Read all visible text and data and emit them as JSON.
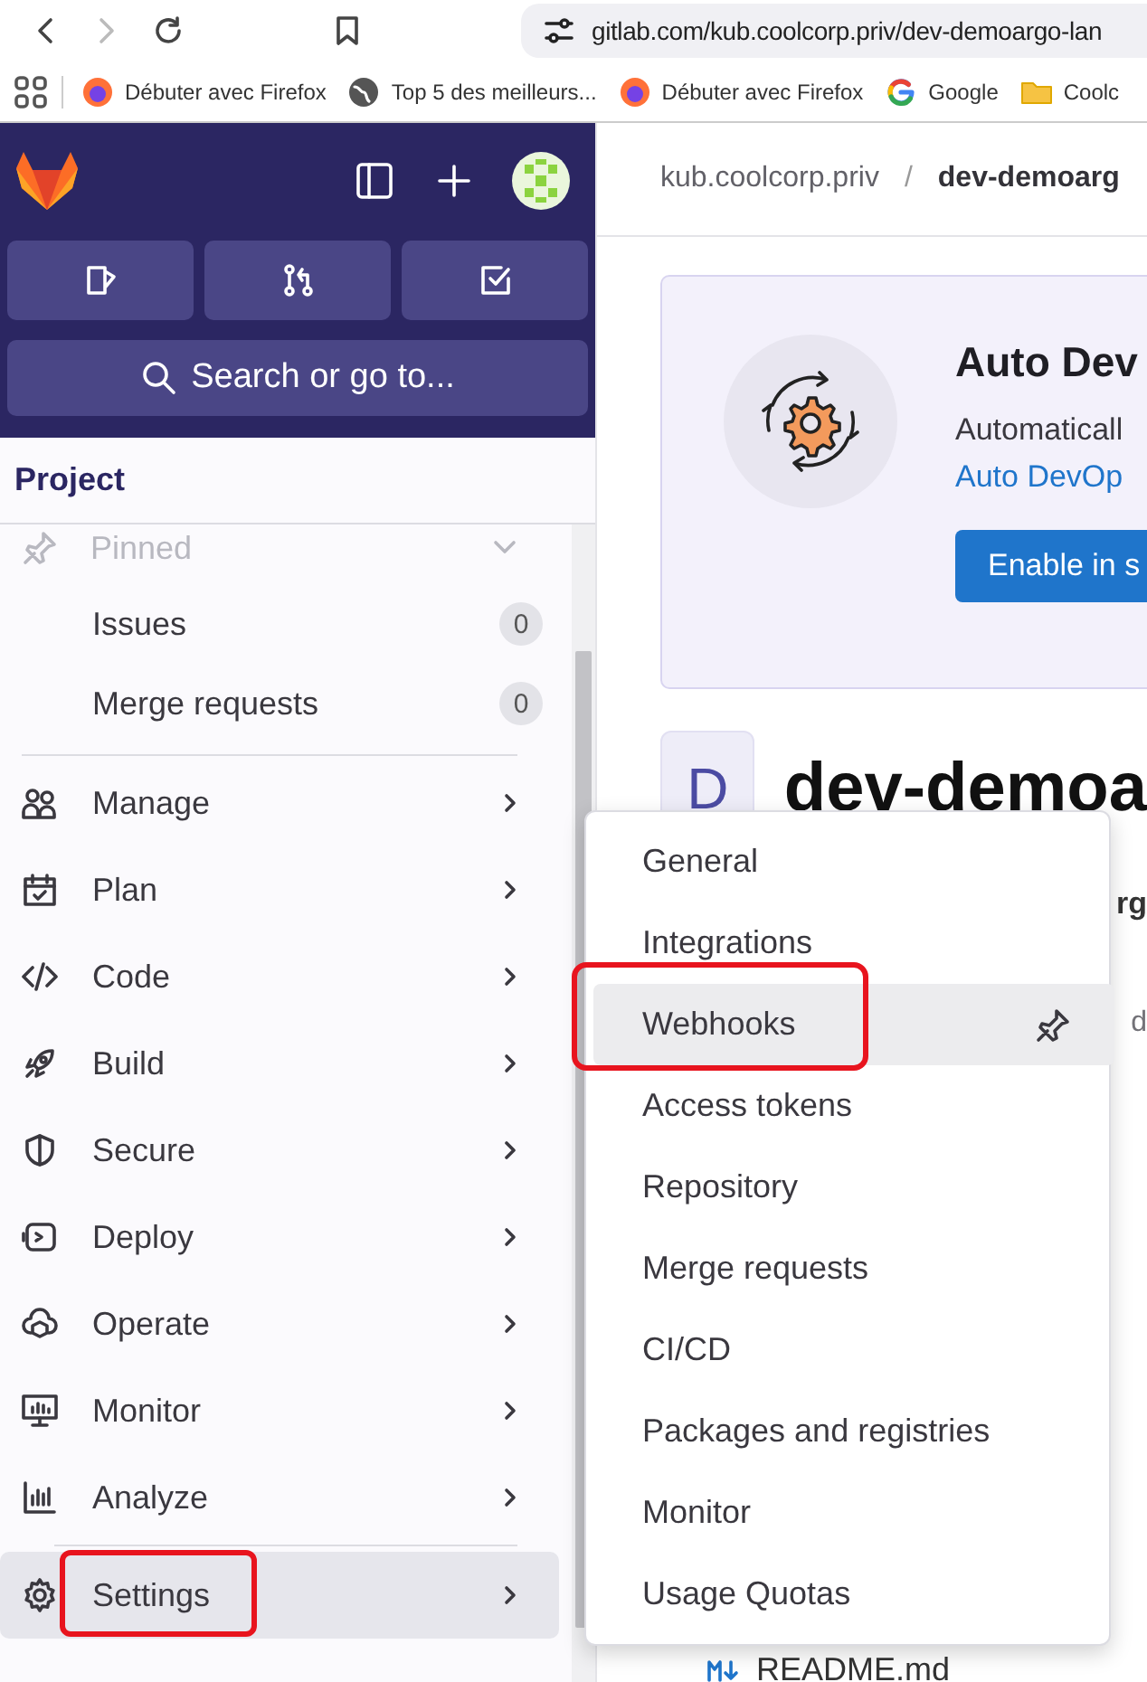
{
  "browser": {
    "back_disabled": false,
    "forward_disabled": true,
    "url": "gitlab.com/kub.coolcorp.priv/dev-demoargo-lan",
    "bookmarks": [
      {
        "label": "Débuter avec Firefox",
        "kind": "firefox"
      },
      {
        "label": "Top 5 des meilleurs...",
        "kind": "globe"
      },
      {
        "label": "Débuter avec Firefox",
        "kind": "firefox"
      },
      {
        "label": "Google",
        "kind": "google"
      },
      {
        "label": "Coolc",
        "kind": "folder"
      }
    ]
  },
  "sidebar": {
    "search": {
      "placeholder": "Search or go to..."
    },
    "context": "Project",
    "pinned": {
      "label": "Pinned",
      "expanded": true,
      "items": [
        {
          "label": "Issues",
          "count": "0"
        },
        {
          "label": "Merge requests",
          "count": "0"
        }
      ]
    },
    "nav": [
      {
        "label": "Manage",
        "selected": false,
        "highlighted": false
      },
      {
        "label": "Plan",
        "selected": false,
        "highlighted": false
      },
      {
        "label": "Code",
        "selected": false,
        "highlighted": false
      },
      {
        "label": "Build",
        "selected": false,
        "highlighted": false
      },
      {
        "label": "Secure",
        "selected": false,
        "highlighted": false
      },
      {
        "label": "Deploy",
        "selected": false,
        "highlighted": false
      },
      {
        "label": "Operate",
        "selected": false,
        "highlighted": false
      },
      {
        "label": "Monitor",
        "selected": false,
        "highlighted": false
      },
      {
        "label": "Analyze",
        "selected": false,
        "highlighted": false
      },
      {
        "label": "Settings",
        "selected": true,
        "highlighted": true
      }
    ]
  },
  "breadcrumb": {
    "items": [
      "kub.coolcorp.priv",
      "dev-demoarg"
    ],
    "separator": "/"
  },
  "banner": {
    "title": "Auto Dev",
    "text": "Automaticall",
    "link": "Auto DevOp",
    "button": "Enable in s"
  },
  "project": {
    "avatar": "D",
    "title": "dev-demoa",
    "fragments": [
      "rg",
      "d"
    ],
    "file": "README.md"
  },
  "flyout": {
    "items": [
      {
        "label": "General",
        "selected": false,
        "highlighted": false
      },
      {
        "label": "Integrations",
        "selected": false,
        "highlighted": false
      },
      {
        "label": "Webhooks",
        "selected": true,
        "highlighted": true
      },
      {
        "label": "Access tokens",
        "selected": false,
        "highlighted": false
      },
      {
        "label": "Repository",
        "selected": false,
        "highlighted": false
      },
      {
        "label": "Merge requests",
        "selected": false,
        "highlighted": false
      },
      {
        "label": "CI/CD",
        "selected": false,
        "highlighted": false
      },
      {
        "label": "Packages and registries",
        "selected": false,
        "highlighted": false
      },
      {
        "label": "Monitor",
        "selected": false,
        "highlighted": false
      },
      {
        "label": "Usage Quotas",
        "selected": false,
        "highlighted": false
      }
    ]
  }
}
